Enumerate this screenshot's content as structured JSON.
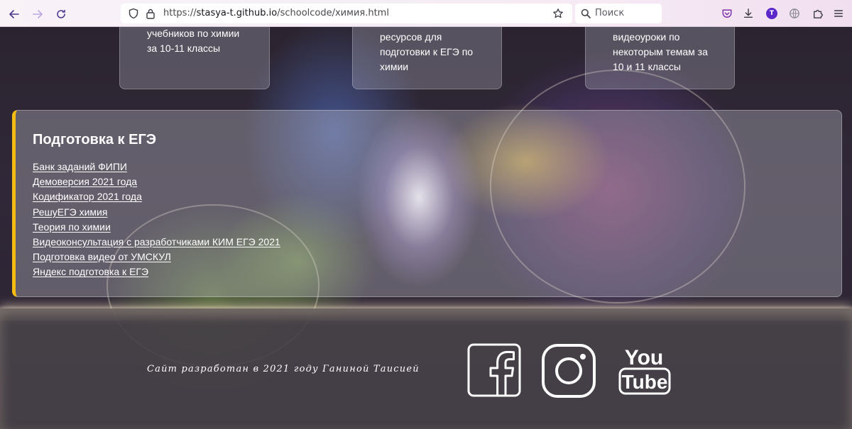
{
  "browser": {
    "url_prefix": "https://",
    "url_host": "stasya-t.github.io",
    "url_path": "/schoolcode/химия.html",
    "search_placeholder": "Поиск",
    "account_initial": "T"
  },
  "cards": [
    {
      "text": "учебников по химии\nза 10-11 классы"
    },
    {
      "text": "ресурсов для\nподготовки к ЕГЭ по\nхимии"
    },
    {
      "text": "видеоуроки по\nнекоторым темам за\n10 и 11 классы"
    }
  ],
  "ege": {
    "title": "Подготовка к ЕГЭ",
    "links": [
      "Банк заданий ФИПИ",
      "Демоверсия 2021 года",
      "Кодификатор 2021 года",
      "РешуЕГЭ химия",
      "Теория по химии",
      "Видеоконсультация с разработчиками КИМ ЕГЭ 2021",
      "Подготовка видео от УМСКУЛ",
      "Яндекс подготовка к ЕГЭ"
    ],
    "accent_color": "#f4bb12"
  },
  "footer": {
    "credit": "Сайт разработан в 2021 году Ганиной Таисией",
    "social": [
      {
        "icon": "facebook-icon"
      },
      {
        "icon": "instagram-icon"
      },
      {
        "icon": "youtube-icon",
        "text_top": "You",
        "text_bottom": "Tube"
      }
    ]
  }
}
